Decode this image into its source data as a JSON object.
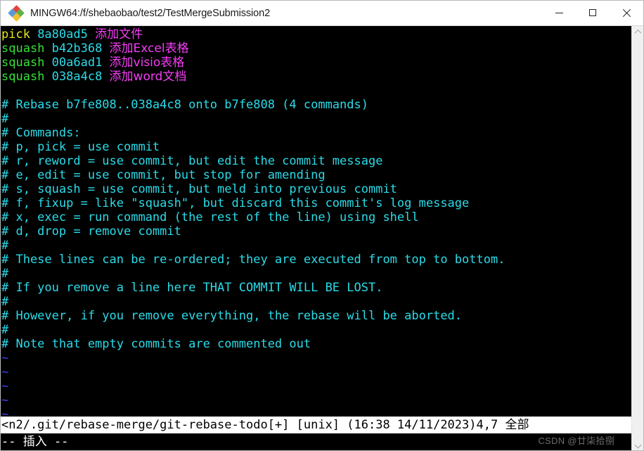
{
  "window": {
    "title": "MINGW64:/f/shebaobao/test2/TestMergeSubmission2",
    "icon": "git-bash-diamond-icon",
    "controls": {
      "minimize": "—",
      "maximize": "□",
      "close": "✕"
    }
  },
  "colors": {
    "background": "#000000",
    "titlebar": "#ffffff",
    "yellow": "#e7e719",
    "green": "#35e135",
    "cyan": "#2bdbe8",
    "magenta": "#f53df5",
    "blue": "#4040ef",
    "white": "#e8e8e8",
    "statusbar_bg": "#ffffff",
    "statusbar_fg": "#000000"
  },
  "editor": {
    "todo_lines": [
      {
        "command": "pick",
        "command_color": "yellow",
        "hash": "8a80ad5",
        "message": "添加文件"
      },
      {
        "command": "squash",
        "command_color": "green",
        "hash": "b42b368",
        "message": "添加Excel表格"
      },
      {
        "command": "squash",
        "command_color": "green",
        "hash": "00a6ad1",
        "message": "添加visio表格"
      },
      {
        "command": "squash",
        "command_color": "green",
        "hash": "038a4c8",
        "message": "添加word文档"
      }
    ],
    "blank_line": "",
    "comment_lines": [
      "# Rebase b7fe808..038a4c8 onto b7fe808 (4 commands)",
      "#",
      "# Commands:",
      "# p, pick = use commit",
      "# r, reword = use commit, but edit the commit message",
      "# e, edit = use commit, but stop for amending",
      "# s, squash = use commit, but meld into previous commit",
      "# f, fixup = like \"squash\", but discard this commit's log message",
      "# x, exec = run command (the rest of the line) using shell",
      "# d, drop = remove commit",
      "#",
      "# These lines can be re-ordered; they are executed from top to bottom.",
      "#",
      "# If you remove a line here THAT COMMIT WILL BE LOST.",
      "#",
      "# However, if you remove everything, the rebase will be aborted.",
      "#",
      "# Note that empty commits are commented out"
    ],
    "empty_markers": [
      "~",
      "~",
      "~",
      "~",
      "~",
      "~"
    ]
  },
  "statusbar": {
    "full_text": "<n2/.git/rebase-merge/git-rebase-todo[+] [unix] (16:38 14/11/2023)4,7 全部",
    "file_path": "<n2/.git/rebase-merge/git-rebase-todo",
    "modified_flag": "[+]",
    "fileformat": "[unix]",
    "timestamp": "(16:38 14/11/2023)",
    "cursor_position": "4,7",
    "scroll_indicator": "全部"
  },
  "modeline": {
    "text": "-- 插入 --"
  },
  "watermark": {
    "text": "CSDN @廿柒拾捌"
  },
  "scrollbar": {
    "up_arrow": "chevron-up-icon",
    "down_arrow": "chevron-down-icon"
  }
}
